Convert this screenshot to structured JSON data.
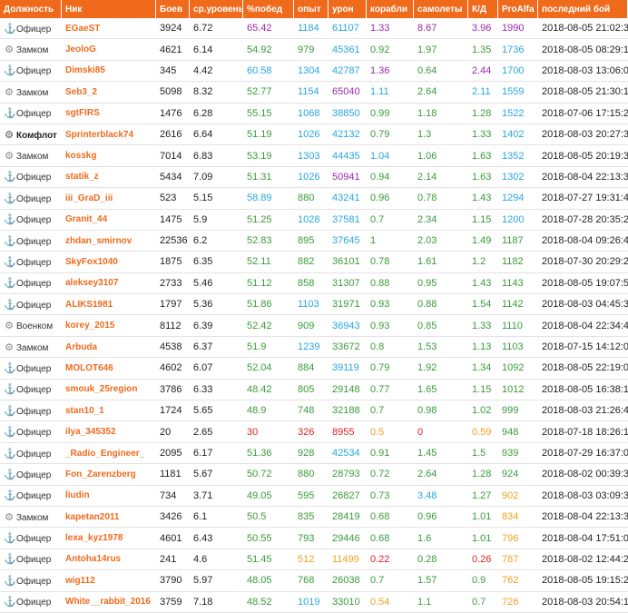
{
  "headers": [
    "Должность",
    "Ник",
    "Боев",
    "ср.уровень",
    "%побед",
    "опыт",
    "урон",
    "корабли",
    "самолеты",
    "К/Д",
    "ProAlfa",
    "последний бой"
  ],
  "colors": {
    "blue": "#28a7e0",
    "green": "#3a9b3a",
    "purple": "#9c27b0",
    "red": "#e0201f",
    "orange": "#f0a020",
    "teal": "#1aa3a3",
    "olive": "#7b9b1a",
    "header": "#f06a1c"
  },
  "rows": [
    {
      "role": "Офицер",
      "icon": "anchor",
      "nick": "EGaeST",
      "battles": "3924",
      "level": "6.72",
      "win": [
        "65.42",
        "purple"
      ],
      "exp": [
        "1184",
        "blue"
      ],
      "dmg": [
        "61107",
        "blue"
      ],
      "ships": [
        "1.33",
        "purple"
      ],
      "planes": [
        "8.67",
        "purple"
      ],
      "kd": [
        "3.96",
        "purple"
      ],
      "pro": [
        "1990",
        "purple"
      ],
      "date": "2018-08-05 21:02:39"
    },
    {
      "role": "Замком",
      "icon": "emblem",
      "nick": "JeoloG",
      "battles": "4621",
      "level": "6.14",
      "win": [
        "54.92",
        "green"
      ],
      "exp": [
        "979",
        "green"
      ],
      "dmg": [
        "45361",
        "blue"
      ],
      "ships": [
        "0.92",
        "green"
      ],
      "planes": [
        "1.97",
        "green"
      ],
      "kd": [
        "1.35",
        "green"
      ],
      "pro": [
        "1736",
        "blue"
      ],
      "date": "2018-08-05 08:29:13"
    },
    {
      "role": "Офицер",
      "icon": "anchor",
      "nick": "Dimski85",
      "battles": "345",
      "level": "4.42",
      "win": [
        "60.58",
        "blue"
      ],
      "exp": [
        "1304",
        "blue"
      ],
      "dmg": [
        "42787",
        "blue"
      ],
      "ships": [
        "1.36",
        "purple"
      ],
      "planes": [
        "0.64",
        "green"
      ],
      "kd": [
        "2.44",
        "purple"
      ],
      "pro": [
        "1700",
        "blue"
      ],
      "date": "2018-08-03 13:06:00"
    },
    {
      "role": "Замком",
      "icon": "emblem",
      "nick": "Seb3_2",
      "battles": "5098",
      "level": "8.32",
      "win": [
        "52.77",
        "green"
      ],
      "exp": [
        "1154",
        "blue"
      ],
      "dmg": [
        "65040",
        "purple"
      ],
      "ships": [
        "1.11",
        "blue"
      ],
      "planes": [
        "2.64",
        "green"
      ],
      "kd": [
        "2.11",
        "blue"
      ],
      "pro": [
        "1559",
        "blue"
      ],
      "date": "2018-08-05 21:30:14"
    },
    {
      "role": "Офицер",
      "icon": "anchor",
      "nick": "sgtFIRS",
      "battles": "1476",
      "level": "6.28",
      "win": [
        "55.15",
        "green"
      ],
      "exp": [
        "1068",
        "blue"
      ],
      "dmg": [
        "38850",
        "blue"
      ],
      "ships": [
        "0.99",
        "green"
      ],
      "planes": [
        "1.18",
        "green"
      ],
      "kd": [
        "1.28",
        "green"
      ],
      "pro": [
        "1522",
        "blue"
      ],
      "date": "2018-07-06 17:15:22"
    },
    {
      "role": "Комфлот",
      "icon": "emblem",
      "nick": "Sprinterblack74",
      "battles": "2616",
      "level": "6.64",
      "win": [
        "51.19",
        "green"
      ],
      "exp": [
        "1026",
        "blue"
      ],
      "dmg": [
        "42132",
        "blue"
      ],
      "ships": [
        "0.79",
        "green"
      ],
      "planes": [
        "1.3",
        "green"
      ],
      "kd": [
        "1.33",
        "green"
      ],
      "pro": [
        "1402",
        "blue"
      ],
      "date": "2018-08-03 20:27:32",
      "hi": true
    },
    {
      "role": "Замком",
      "icon": "emblem",
      "nick": "kosskg",
      "battles": "7014",
      "level": "6.83",
      "win": [
        "53.19",
        "green"
      ],
      "exp": [
        "1303",
        "blue"
      ],
      "dmg": [
        "44435",
        "blue"
      ],
      "ships": [
        "1.04",
        "blue"
      ],
      "planes": [
        "1.06",
        "green"
      ],
      "kd": [
        "1.63",
        "green"
      ],
      "pro": [
        "1352",
        "blue"
      ],
      "date": "2018-08-05 20:19:35"
    },
    {
      "role": "Офицер",
      "icon": "anchor",
      "nick": "statik_z",
      "battles": "5434",
      "level": "7.09",
      "win": [
        "51.31",
        "green"
      ],
      "exp": [
        "1026",
        "blue"
      ],
      "dmg": [
        "50941",
        "purple"
      ],
      "ships": [
        "0.94",
        "green"
      ],
      "planes": [
        "2.14",
        "green"
      ],
      "kd": [
        "1.63",
        "green"
      ],
      "pro": [
        "1302",
        "blue"
      ],
      "date": "2018-08-04 22:13:35"
    },
    {
      "role": "Офицер",
      "icon": "anchor",
      "nick": "iii_GraD_iii",
      "battles": "523",
      "level": "5.15",
      "win": [
        "58.89",
        "blue"
      ],
      "exp": [
        "880",
        "green"
      ],
      "dmg": [
        "43241",
        "blue"
      ],
      "ships": [
        "0.96",
        "green"
      ],
      "planes": [
        "0.78",
        "green"
      ],
      "kd": [
        "1.43",
        "green"
      ],
      "pro": [
        "1294",
        "blue"
      ],
      "date": "2018-07-27 19:31:49"
    },
    {
      "role": "Офицер",
      "icon": "anchor",
      "nick": "Granit_44",
      "battles": "1475",
      "level": "5.9",
      "win": [
        "51.25",
        "green"
      ],
      "exp": [
        "1028",
        "blue"
      ],
      "dmg": [
        "37581",
        "blue"
      ],
      "ships": [
        "0.7",
        "green"
      ],
      "planes": [
        "2.34",
        "green"
      ],
      "kd": [
        "1.15",
        "green"
      ],
      "pro": [
        "1200",
        "blue"
      ],
      "date": "2018-07-28 20:35:28"
    },
    {
      "role": "Офицер",
      "icon": "anchor",
      "nick": "zhdan_smirnov",
      "battles": "22536",
      "level": "6.2",
      "win": [
        "52.83",
        "green"
      ],
      "exp": [
        "895",
        "green"
      ],
      "dmg": [
        "37645",
        "blue"
      ],
      "ships": [
        "1",
        "green"
      ],
      "planes": [
        "2.03",
        "green"
      ],
      "kd": [
        "1.49",
        "green"
      ],
      "pro": [
        "1187",
        "green"
      ],
      "date": "2018-08-04 09:26:46"
    },
    {
      "role": "Офицер",
      "icon": "anchor",
      "nick": "SkyFox1040",
      "battles": "1875",
      "level": "6.35",
      "win": [
        "52.11",
        "green"
      ],
      "exp": [
        "882",
        "green"
      ],
      "dmg": [
        "36101",
        "green"
      ],
      "ships": [
        "0.78",
        "green"
      ],
      "planes": [
        "1.61",
        "green"
      ],
      "kd": [
        "1.2",
        "green"
      ],
      "pro": [
        "1182",
        "green"
      ],
      "date": "2018-07-30 20:29:27"
    },
    {
      "role": "Офицер",
      "icon": "anchor",
      "nick": "aleksey3107",
      "battles": "2733",
      "level": "5.46",
      "win": [
        "51.12",
        "green"
      ],
      "exp": [
        "858",
        "green"
      ],
      "dmg": [
        "31307",
        "green"
      ],
      "ships": [
        "0.88",
        "green"
      ],
      "planes": [
        "0.95",
        "green"
      ],
      "kd": [
        "1.43",
        "green"
      ],
      "pro": [
        "1143",
        "green"
      ],
      "date": "2018-08-05 19:07:51"
    },
    {
      "role": "Офицер",
      "icon": "anchor",
      "nick": "ALIKS1981",
      "battles": "1797",
      "level": "5.36",
      "win": [
        "51.86",
        "green"
      ],
      "exp": [
        "1103",
        "blue"
      ],
      "dmg": [
        "31971",
        "green"
      ],
      "ships": [
        "0.93",
        "green"
      ],
      "planes": [
        "0.88",
        "green"
      ],
      "kd": [
        "1.54",
        "green"
      ],
      "pro": [
        "1142",
        "green"
      ],
      "date": "2018-08-03 04:45:32"
    },
    {
      "role": "Военком",
      "icon": "emblem",
      "nick": "korey_2015",
      "battles": "8112",
      "level": "6.39",
      "win": [
        "52.42",
        "green"
      ],
      "exp": [
        "909",
        "green"
      ],
      "dmg": [
        "36943",
        "blue"
      ],
      "ships": [
        "0.93",
        "green"
      ],
      "planes": [
        "0.85",
        "green"
      ],
      "kd": [
        "1.33",
        "green"
      ],
      "pro": [
        "1110",
        "green"
      ],
      "date": "2018-08-04 22:34:46"
    },
    {
      "role": "Замком",
      "icon": "emblem",
      "nick": "Arbuda",
      "battles": "4538",
      "level": "6.37",
      "win": [
        "51.9",
        "green"
      ],
      "exp": [
        "1239",
        "blue"
      ],
      "dmg": [
        "33672",
        "green"
      ],
      "ships": [
        "0.8",
        "green"
      ],
      "planes": [
        "1.53",
        "green"
      ],
      "kd": [
        "1.13",
        "green"
      ],
      "pro": [
        "1103",
        "green"
      ],
      "date": "2018-07-15 14:12:00"
    },
    {
      "role": "Офицер",
      "icon": "anchor",
      "nick": "MOLOT646",
      "battles": "4602",
      "level": "6.07",
      "win": [
        "52.04",
        "green"
      ],
      "exp": [
        "884",
        "green"
      ],
      "dmg": [
        "39119",
        "blue"
      ],
      "ships": [
        "0.79",
        "green"
      ],
      "planes": [
        "1.92",
        "green"
      ],
      "kd": [
        "1.34",
        "green"
      ],
      "pro": [
        "1092",
        "green"
      ],
      "date": "2018-08-05 22:19:09"
    },
    {
      "role": "Офицер",
      "icon": "anchor",
      "nick": "smouk_25region",
      "battles": "3786",
      "level": "6.33",
      "win": [
        "48.42",
        "green"
      ],
      "exp": [
        "805",
        "green"
      ],
      "dmg": [
        "29148",
        "green"
      ],
      "ships": [
        "0.77",
        "green"
      ],
      "planes": [
        "1.65",
        "green"
      ],
      "kd": [
        "1.15",
        "green"
      ],
      "pro": [
        "1012",
        "green"
      ],
      "date": "2018-08-05 16:38:18"
    },
    {
      "role": "Офицер",
      "icon": "anchor",
      "nick": "stan10_1",
      "battles": "1724",
      "level": "5.65",
      "win": [
        "48.9",
        "green"
      ],
      "exp": [
        "748",
        "green"
      ],
      "dmg": [
        "32188",
        "green"
      ],
      "ships": [
        "0.7",
        "green"
      ],
      "planes": [
        "0.98",
        "green"
      ],
      "kd": [
        "1.02",
        "green"
      ],
      "pro": [
        "999",
        "green"
      ],
      "date": "2018-08-03 21:26:42"
    },
    {
      "role": "Офицер",
      "icon": "anchor",
      "nick": "ilya_345352",
      "battles": "20",
      "level": "2.65",
      "win": [
        "30",
        "red"
      ],
      "exp": [
        "326",
        "red"
      ],
      "dmg": [
        "8955",
        "red"
      ],
      "ships": [
        "0.5",
        "orange"
      ],
      "planes": [
        "0",
        "red"
      ],
      "kd": [
        "0.59",
        "orange"
      ],
      "pro": [
        "948",
        "green"
      ],
      "date": "2018-07-18 18:26:16"
    },
    {
      "role": "Офицер",
      "icon": "anchor",
      "nick": "_Radio_Engineer_",
      "battles": "2095",
      "level": "6.17",
      "win": [
        "51.36",
        "green"
      ],
      "exp": [
        "928",
        "green"
      ],
      "dmg": [
        "42534",
        "blue"
      ],
      "ships": [
        "0.91",
        "green"
      ],
      "planes": [
        "1.45",
        "green"
      ],
      "kd": [
        "1.5",
        "green"
      ],
      "pro": [
        "939",
        "green"
      ],
      "date": "2018-07-29 16:37:02"
    },
    {
      "role": "Офицер",
      "icon": "anchor",
      "nick": "Fon_Zarenzberg",
      "battles": "1181",
      "level": "5.67",
      "win": [
        "50.72",
        "green"
      ],
      "exp": [
        "880",
        "green"
      ],
      "dmg": [
        "28793",
        "green"
      ],
      "ships": [
        "0.72",
        "green"
      ],
      "planes": [
        "2.64",
        "green"
      ],
      "kd": [
        "1.28",
        "green"
      ],
      "pro": [
        "924",
        "green"
      ],
      "date": "2018-08-02 00:39:32"
    },
    {
      "role": "Офицер",
      "icon": "anchor",
      "nick": "liudin",
      "battles": "734",
      "level": "3.71",
      "win": [
        "49.05",
        "green"
      ],
      "exp": [
        "595",
        "green"
      ],
      "dmg": [
        "26827",
        "green"
      ],
      "ships": [
        "0.73",
        "green"
      ],
      "planes": [
        "3.48",
        "blue"
      ],
      "kd": [
        "1.27",
        "green"
      ],
      "pro": [
        "902",
        "orange"
      ],
      "date": "2018-08-03 03:09:39"
    },
    {
      "role": "Замком",
      "icon": "emblem",
      "nick": "kapetan2011",
      "battles": "3426",
      "level": "6.1",
      "win": [
        "50.5",
        "green"
      ],
      "exp": [
        "835",
        "green"
      ],
      "dmg": [
        "28419",
        "green"
      ],
      "ships": [
        "0.68",
        "green"
      ],
      "planes": [
        "0.96",
        "green"
      ],
      "kd": [
        "1.01",
        "green"
      ],
      "pro": [
        "834",
        "orange"
      ],
      "date": "2018-08-04 22:13:35"
    },
    {
      "role": "Офицер",
      "icon": "anchor",
      "nick": "lexa_kyz1978",
      "battles": "4601",
      "level": "6.43",
      "win": [
        "50.55",
        "green"
      ],
      "exp": [
        "793",
        "green"
      ],
      "dmg": [
        "29446",
        "green"
      ],
      "ships": [
        "0.68",
        "green"
      ],
      "planes": [
        "1.6",
        "green"
      ],
      "kd": [
        "1.01",
        "green"
      ],
      "pro": [
        "796",
        "orange"
      ],
      "date": "2018-08-04 17:51:04"
    },
    {
      "role": "Офицер",
      "icon": "anchor",
      "nick": "Antoha14rus",
      "battles": "241",
      "level": "4.6",
      "win": [
        "51.45",
        "green"
      ],
      "exp": [
        "512",
        "orange"
      ],
      "dmg": [
        "11499",
        "orange"
      ],
      "ships": [
        "0.22",
        "red"
      ],
      "planes": [
        "0.28",
        "green"
      ],
      "kd": [
        "0.26",
        "red"
      ],
      "pro": [
        "787",
        "orange"
      ],
      "date": "2018-08-02 12:44:21"
    },
    {
      "role": "Офицер",
      "icon": "anchor",
      "nick": "wig112",
      "battles": "3790",
      "level": "5.97",
      "win": [
        "48.05",
        "green"
      ],
      "exp": [
        "768",
        "green"
      ],
      "dmg": [
        "26038",
        "green"
      ],
      "ships": [
        "0.7",
        "green"
      ],
      "planes": [
        "1.57",
        "green"
      ],
      "kd": [
        "0.9",
        "green"
      ],
      "pro": [
        "762",
        "orange"
      ],
      "date": "2018-08-05 19:15:28"
    },
    {
      "role": "Офицер",
      "icon": "anchor",
      "nick": "White__rabbit_2016",
      "battles": "3759",
      "level": "7.18",
      "win": [
        "48.52",
        "green"
      ],
      "exp": [
        "1019",
        "blue"
      ],
      "dmg": [
        "33010",
        "green"
      ],
      "ships": [
        "0.54",
        "orange"
      ],
      "planes": [
        "1.1",
        "green"
      ],
      "kd": [
        "0.7",
        "green"
      ],
      "pro": [
        "726",
        "orange"
      ],
      "date": "2018-08-03 20:54:17"
    }
  ]
}
